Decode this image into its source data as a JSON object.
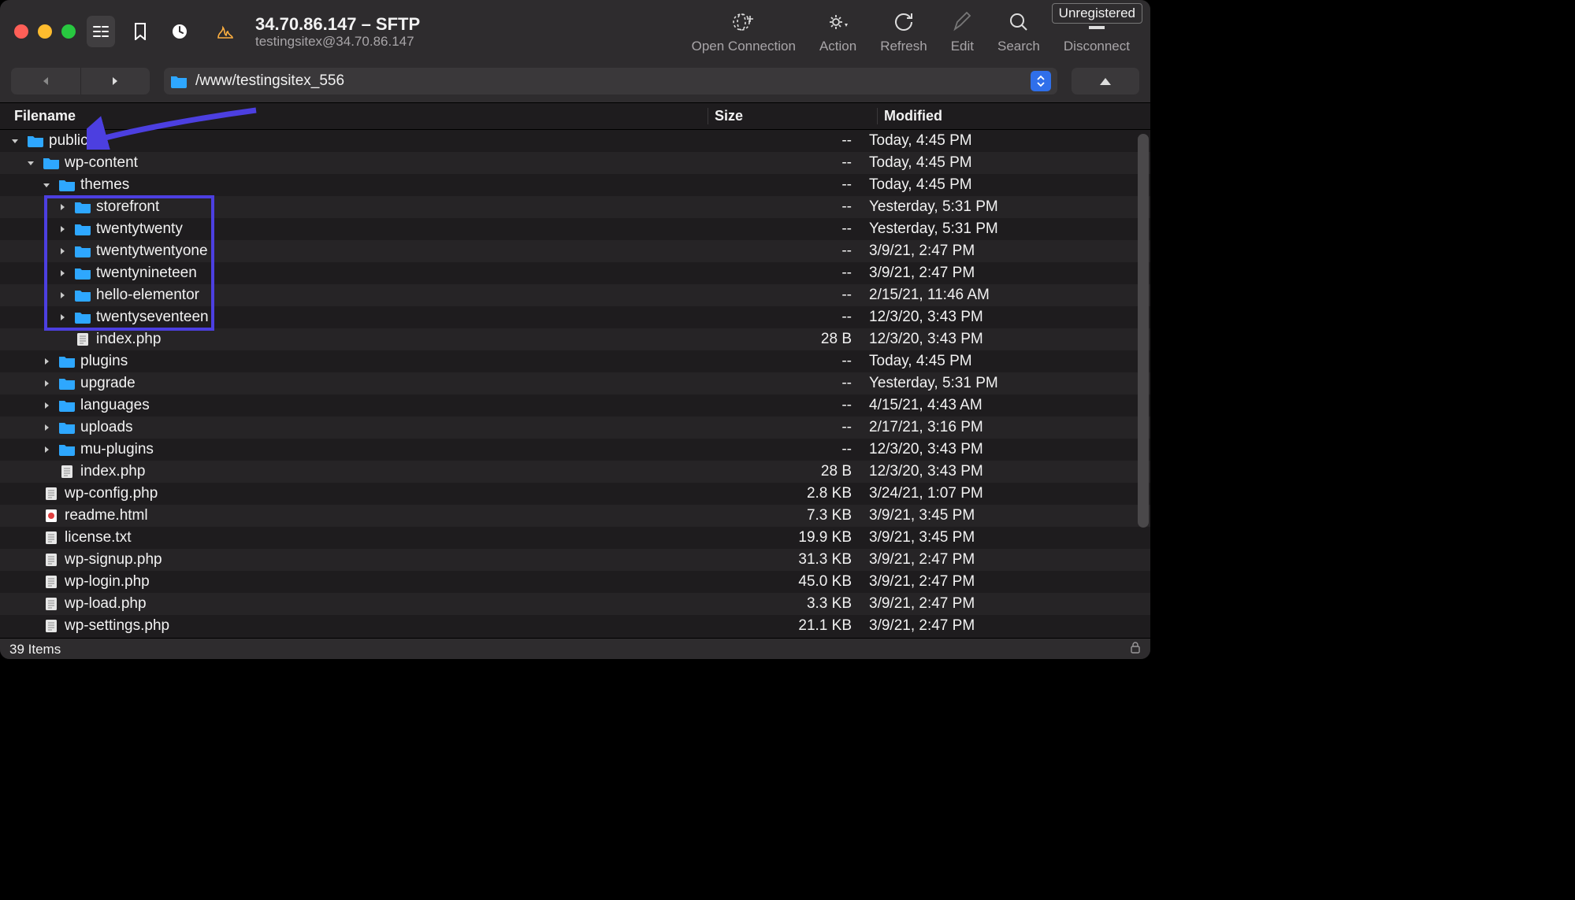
{
  "tag": "Unregistered",
  "title": "34.70.86.147 – SFTP",
  "subtitle": "testingsitex@34.70.86.147",
  "toolbar": {
    "open_connection": "Open Connection",
    "action": "Action",
    "refresh": "Refresh",
    "edit": "Edit",
    "search": "Search",
    "disconnect": "Disconnect"
  },
  "path": "/www/testingsitex_556",
  "columns": {
    "name": "Filename",
    "size": "Size",
    "modified": "Modified"
  },
  "rows": [
    {
      "indent": 0,
      "dis": "open",
      "kind": "folder",
      "name": "public",
      "size": "--",
      "mod": "Today, 4:45 PM"
    },
    {
      "indent": 1,
      "dis": "open",
      "kind": "folder",
      "name": "wp-content",
      "size": "--",
      "mod": "Today, 4:45 PM"
    },
    {
      "indent": 2,
      "dis": "open",
      "kind": "folder",
      "name": "themes",
      "size": "--",
      "mod": "Today, 4:45 PM"
    },
    {
      "indent": 3,
      "dis": "closed",
      "kind": "folder",
      "name": "storefront",
      "size": "--",
      "mod": "Yesterday, 5:31 PM"
    },
    {
      "indent": 3,
      "dis": "closed",
      "kind": "folder",
      "name": "twentytwenty",
      "size": "--",
      "mod": "Yesterday, 5:31 PM"
    },
    {
      "indent": 3,
      "dis": "closed",
      "kind": "folder",
      "name": "twentytwentyone",
      "size": "--",
      "mod": "3/9/21, 2:47 PM"
    },
    {
      "indent": 3,
      "dis": "closed",
      "kind": "folder",
      "name": "twentynineteen",
      "size": "--",
      "mod": "3/9/21, 2:47 PM"
    },
    {
      "indent": 3,
      "dis": "closed",
      "kind": "folder",
      "name": "hello-elementor",
      "size": "--",
      "mod": "2/15/21, 11:46 AM"
    },
    {
      "indent": 3,
      "dis": "closed",
      "kind": "folder",
      "name": "twentyseventeen",
      "size": "--",
      "mod": "12/3/20, 3:43 PM"
    },
    {
      "indent": 3,
      "dis": "none",
      "kind": "file",
      "name": "index.php",
      "size": "28 B",
      "mod": "12/3/20, 3:43 PM"
    },
    {
      "indent": 2,
      "dis": "closed",
      "kind": "folder",
      "name": "plugins",
      "size": "--",
      "mod": "Today, 4:45 PM"
    },
    {
      "indent": 2,
      "dis": "closed",
      "kind": "folder",
      "name": "upgrade",
      "size": "--",
      "mod": "Yesterday, 5:31 PM"
    },
    {
      "indent": 2,
      "dis": "closed",
      "kind": "folder",
      "name": "languages",
      "size": "--",
      "mod": "4/15/21, 4:43 AM"
    },
    {
      "indent": 2,
      "dis": "closed",
      "kind": "folder",
      "name": "uploads",
      "size": "--",
      "mod": "2/17/21, 3:16 PM"
    },
    {
      "indent": 2,
      "dis": "closed",
      "kind": "folder",
      "name": "mu-plugins",
      "size": "--",
      "mod": "12/3/20, 3:43 PM"
    },
    {
      "indent": 2,
      "dis": "none",
      "kind": "file",
      "name": "index.php",
      "size": "28 B",
      "mod": "12/3/20, 3:43 PM"
    },
    {
      "indent": 1,
      "dis": "none",
      "kind": "file",
      "name": "wp-config.php",
      "size": "2.8 KB",
      "mod": "3/24/21, 1:07 PM"
    },
    {
      "indent": 1,
      "dis": "none",
      "kind": "html",
      "name": "readme.html",
      "size": "7.3 KB",
      "mod": "3/9/21, 3:45 PM"
    },
    {
      "indent": 1,
      "dis": "none",
      "kind": "file",
      "name": "license.txt",
      "size": "19.9 KB",
      "mod": "3/9/21, 3:45 PM"
    },
    {
      "indent": 1,
      "dis": "none",
      "kind": "file",
      "name": "wp-signup.php",
      "size": "31.3 KB",
      "mod": "3/9/21, 2:47 PM"
    },
    {
      "indent": 1,
      "dis": "none",
      "kind": "file",
      "name": "wp-login.php",
      "size": "45.0 KB",
      "mod": "3/9/21, 2:47 PM"
    },
    {
      "indent": 1,
      "dis": "none",
      "kind": "file",
      "name": "wp-load.php",
      "size": "3.3 KB",
      "mod": "3/9/21, 2:47 PM"
    },
    {
      "indent": 1,
      "dis": "none",
      "kind": "file",
      "name": "wp-settings.php",
      "size": "21.1 KB",
      "mod": "3/9/21, 2:47 PM"
    }
  ],
  "status": "39 Items"
}
